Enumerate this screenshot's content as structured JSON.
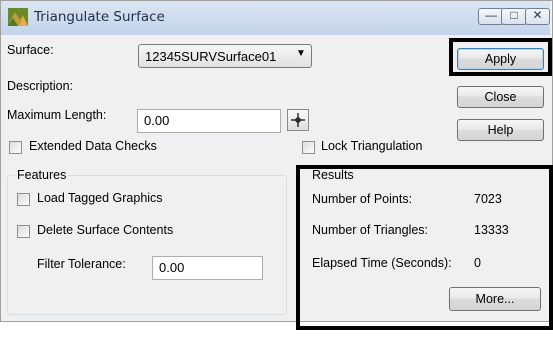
{
  "window": {
    "title": "Triangulate Surface"
  },
  "titlebar_buttons": {
    "minimize": "—",
    "maximize": "□",
    "close": "✕"
  },
  "form": {
    "surface_label": "Surface:",
    "surface_value": "12345SURVSurface01",
    "description_label": "Description:",
    "max_length_label": "Maximum Length:",
    "max_length_value": "0.00",
    "extended_checks_label": "Extended Data Checks",
    "lock_triangulation_label": "Lock Triangulation"
  },
  "buttons": {
    "apply": "Apply",
    "close": "Close",
    "help": "Help",
    "more": "More..."
  },
  "features": {
    "title": "Features",
    "load_tagged": "Load Tagged Graphics",
    "delete_contents": "Delete Surface Contents",
    "filter_label": "Filter Tolerance:",
    "filter_value": "0.00"
  },
  "results": {
    "title": "Results",
    "rows": [
      {
        "label": "Number of Points:",
        "value": "7023"
      },
      {
        "label": "Number of Triangles:",
        "value": "13333"
      },
      {
        "label": "Elapsed Time (Seconds):",
        "value": "0"
      }
    ]
  }
}
